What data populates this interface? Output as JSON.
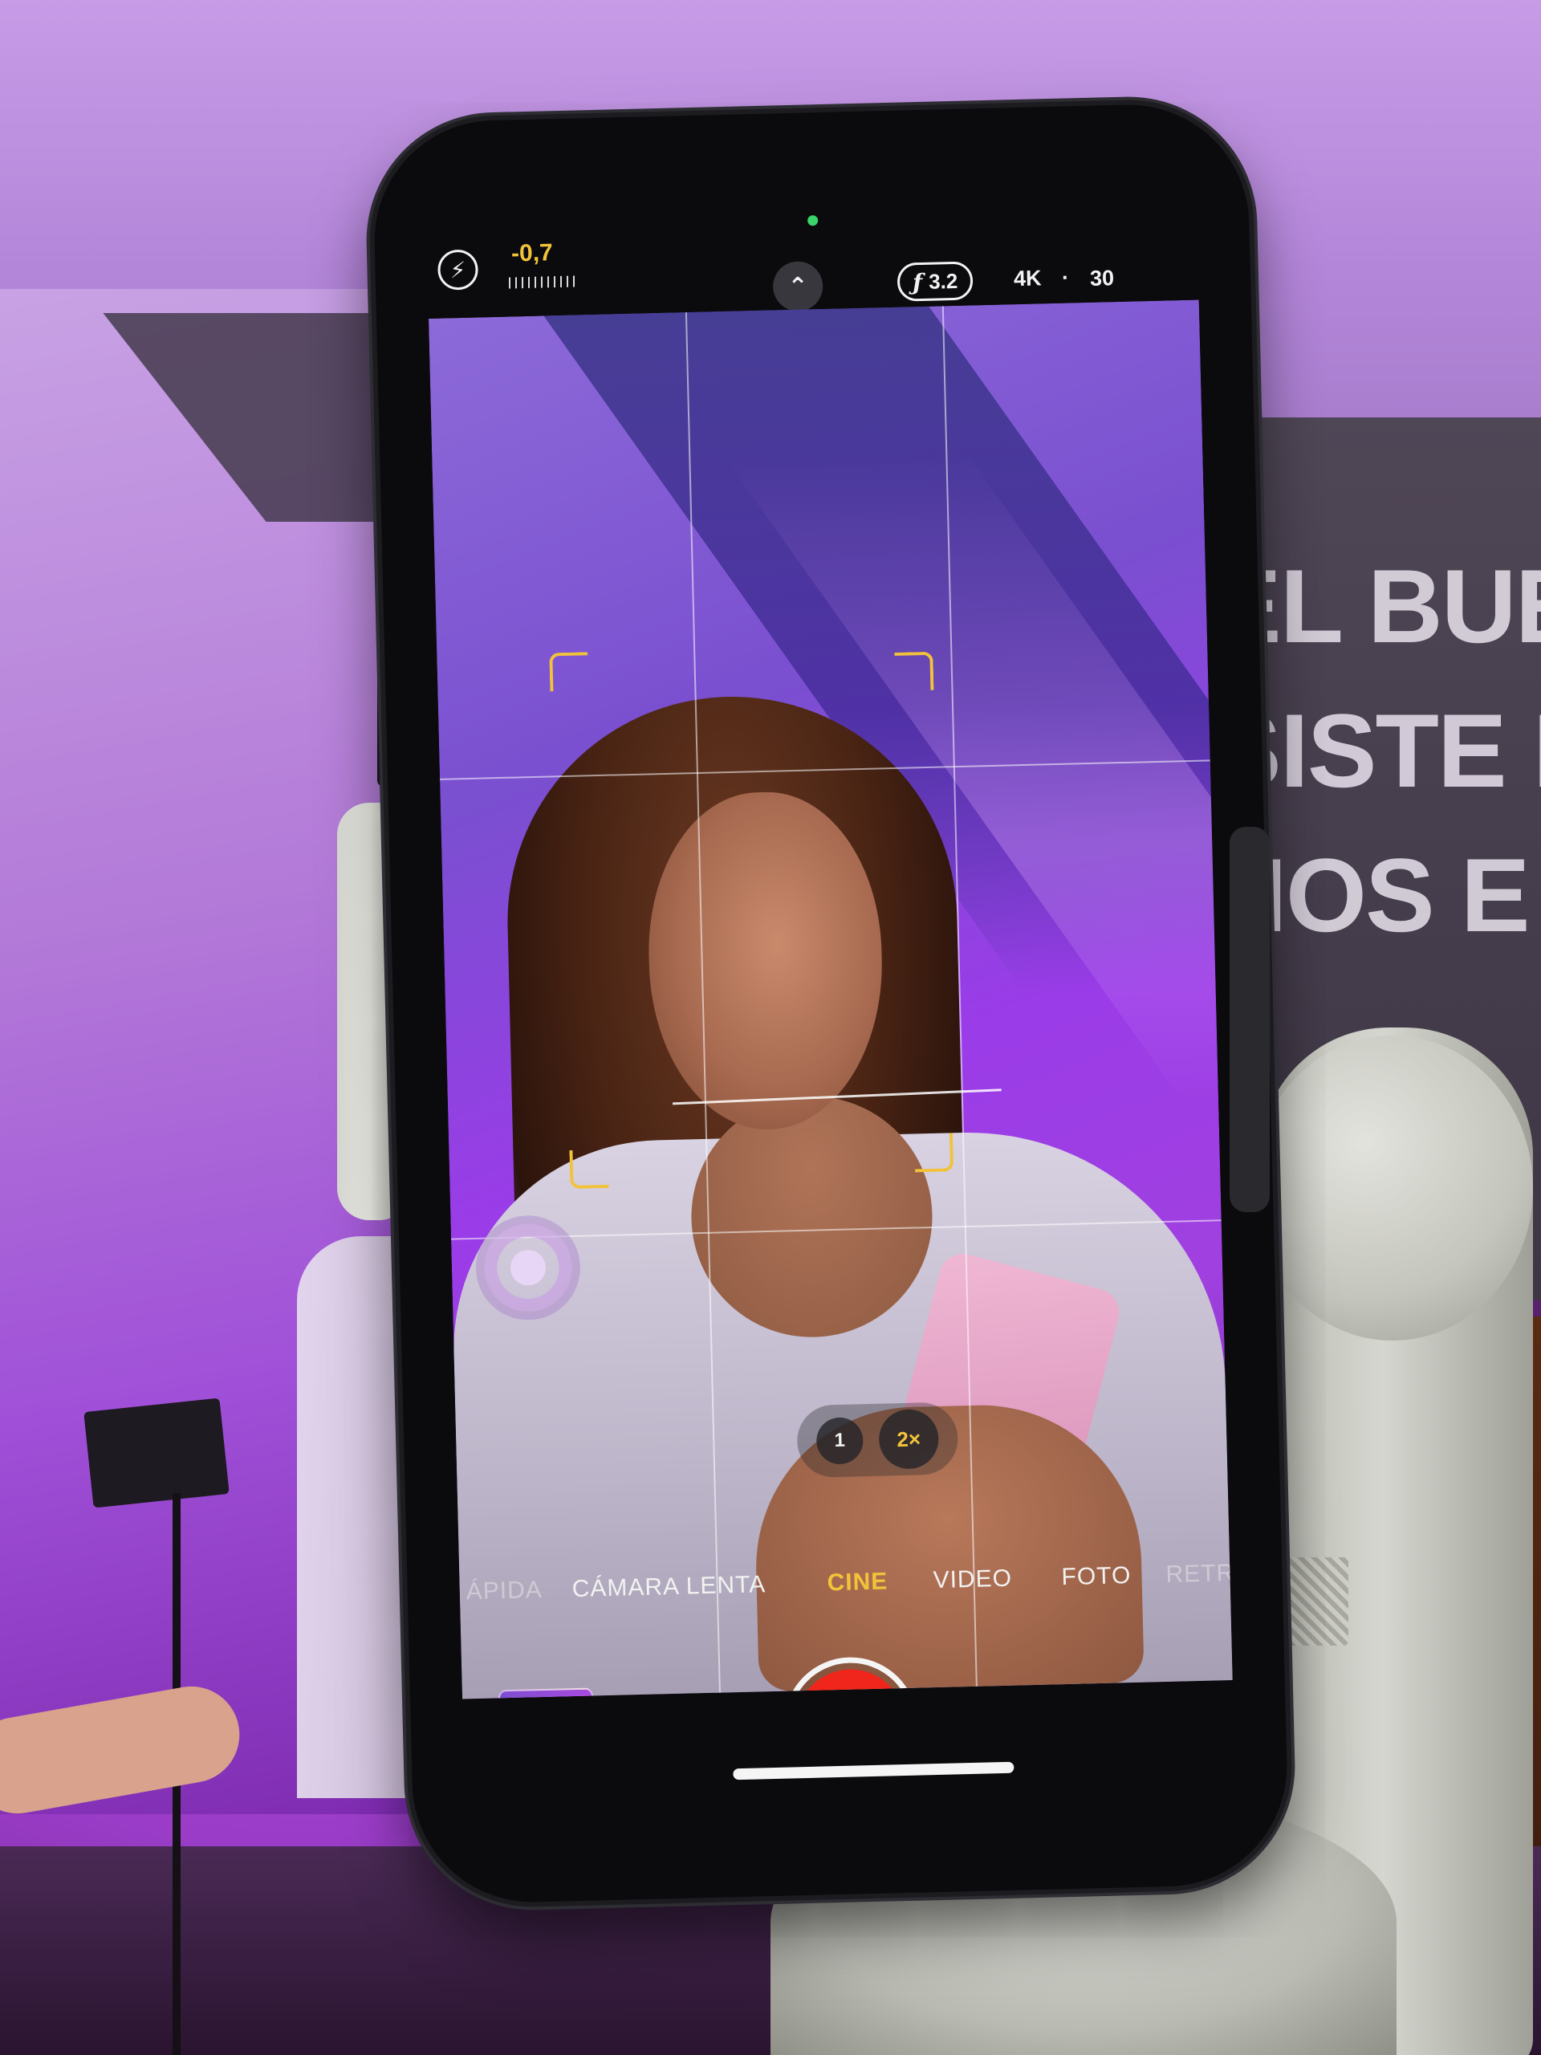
{
  "camera": {
    "top_bar": {
      "exposure_value": "-0,7",
      "aperture_value": "3.2",
      "resolution": "4K",
      "separator": "·",
      "frame_rate": "30"
    },
    "zoom": {
      "options": [
        "1",
        "2×"
      ],
      "selected": "2×"
    },
    "modes": [
      {
        "label": "ÁPIDA",
        "state": "dim"
      },
      {
        "label": "CÁMARA LENTA",
        "state": "normal"
      },
      {
        "label": "CINE",
        "state": "active"
      },
      {
        "label": "VIDEO",
        "state": "normal"
      },
      {
        "label": "FOTO",
        "state": "normal"
      },
      {
        "label": "RETRA",
        "state": "dim"
      }
    ],
    "accent_color": "#f2c33a",
    "record_color": "#f0261c",
    "icons": {
      "flash": "flash-icon",
      "chevron": "chevron-up-icon",
      "aperture": "f-stop-icon",
      "flip": "flip-camera-icon"
    }
  },
  "background_sign": {
    "line1": "EL BUEN",
    "line2": "SISTE E",
    "line3": "ÑOS E"
  }
}
